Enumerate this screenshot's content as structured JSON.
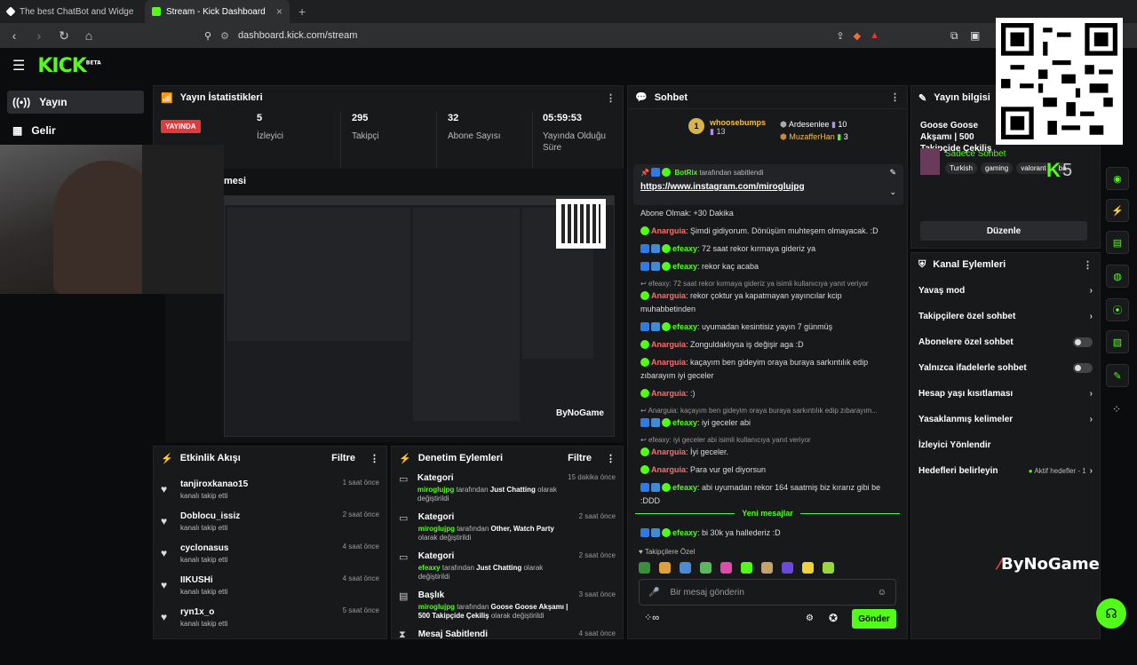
{
  "browser": {
    "tabs": [
      {
        "title": "The best ChatBot and Widgets for Ki",
        "active": false
      },
      {
        "title": "Stream - Kick Dashboard",
        "active": true
      }
    ],
    "url": "dashboard.kick.com/stream"
  },
  "brand": {
    "logo": "KICK",
    "beta": "BETA",
    "accent": "#53fc18"
  },
  "sidebar": {
    "items": [
      {
        "label": "Yayın",
        "icon": "broadcast-icon"
      },
      {
        "label": "Gelir",
        "icon": "revenue-icon"
      }
    ]
  },
  "stats": {
    "title": "Yayın İstatistikleri",
    "live_badge": "YAYINDA",
    "items": [
      {
        "value": "5",
        "label": "İzleyici"
      },
      {
        "value": "295",
        "label": "Takipçi"
      },
      {
        "value": "32",
        "label": "Abone Sayısı"
      },
      {
        "value": "05:59:53",
        "label": "Yayında Olduğu Süre"
      }
    ]
  },
  "preview": {
    "title_fragment": "mesi"
  },
  "activity": {
    "title": "Etkinlik Akışı",
    "filter": "Filtre",
    "items": [
      {
        "name": "tanjiroxkanao15",
        "sub": "kanalı takip etti",
        "time": "1 saat önce"
      },
      {
        "name": "Doblocu_issiz",
        "sub": "kanalı takip etti",
        "time": "2 saat önce"
      },
      {
        "name": "cyclonasus",
        "sub": "kanalı takip etti",
        "time": "4 saat önce"
      },
      {
        "name": "IIKUSHi",
        "sub": "kanalı takip etti",
        "time": "4 saat önce"
      },
      {
        "name": "ryn1x_o",
        "sub": "kanalı takip etti",
        "time": "5 saat önce"
      }
    ]
  },
  "moderation": {
    "title": "Denetim Eylemleri",
    "filter": "Filtre",
    "items": [
      {
        "kind": "Kategori",
        "user": "miroglujpg",
        "mid": "tarafından",
        "value": "Just Chatting",
        "end": "olarak değiştirildi",
        "time": "15 dakika önce"
      },
      {
        "kind": "Kategori",
        "user": "miroglujpg",
        "mid": "tarafından",
        "value": "Other, Watch Party",
        "end": "olarak değiştirildi",
        "time": "2 saat önce"
      },
      {
        "kind": "Kategori",
        "user": "efeaxy",
        "mid": "tarafından",
        "value": "Just Chatting",
        "end": "olarak değiştirildi",
        "time": "2 saat önce"
      },
      {
        "kind": "Başlık",
        "user": "miroglujpg",
        "mid": "tarafından",
        "value": "Goose Goose Akşamı | 500 Takipçide Çekiliş",
        "end": "olarak değiştirildi",
        "time": "3 saat önce"
      },
      {
        "kind": "Mesaj Sabitlendi",
        "user": "",
        "mid": "",
        "value": "",
        "end": "",
        "time": "4 saat önce"
      }
    ]
  },
  "chat": {
    "title": "Sohbet",
    "leaders": [
      {
        "rank": "1",
        "name": "whoosebumps",
        "count": "13"
      },
      {
        "name": "Ardesenlee",
        "count": "10"
      },
      {
        "name": "MuzafferHan",
        "count": "3"
      }
    ],
    "pinned": {
      "by": "BotRix",
      "by_text": "tarafından sabitlendi",
      "link": "https://www.instagram.com/miroglujpg"
    },
    "messages": [
      {
        "type": "plain",
        "text": "Abone Olmak: +30 Dakika"
      },
      {
        "type": "msg",
        "user": "Anarguia",
        "color": "#ff6b6b",
        "text": ": Şimdi gidiyorum. Dönüşüm muhteşem olmayacak. :D"
      },
      {
        "type": "msg",
        "user": "efeaxy",
        "color": "#53fc18",
        "text": ": 72 saat rekor kırmaya gideriz ya"
      },
      {
        "type": "msg",
        "user": "efeaxy",
        "color": "#53fc18",
        "text": ": rekor kaç acaba"
      },
      {
        "type": "reply",
        "text": "efeaxy: 72 saat rekor kırmaya gideriz ya isimli kullanıcıya yanıt veriyor"
      },
      {
        "type": "msg",
        "user": "Anarguia",
        "color": "#ff6b6b",
        "text": ": rekor çoktur ya kapatmayan yayıncılar kcip muhabbetinden"
      },
      {
        "type": "msg",
        "user": "efeaxy",
        "color": "#53fc18",
        "text": ": uyumadan kesintisiz yayın 7 günmüş"
      },
      {
        "type": "msg",
        "user": "Anarguia",
        "color": "#ff6b6b",
        "text": ": Zonguldaklıysa iş değişir aga :D"
      },
      {
        "type": "msg",
        "user": "Anarguia",
        "color": "#ff6b6b",
        "text": ": kaçayım ben gideyim oraya buraya sarkıntılık edip zıbarayım iyi geceler"
      },
      {
        "type": "msg",
        "user": "Anarguia",
        "color": "#ff6b6b",
        "text": ": :)"
      },
      {
        "type": "reply",
        "text": "Anarguia: kaçayım ben gideyim oraya buraya sarkıntılık edip zıbarayım..."
      },
      {
        "type": "msg",
        "user": "efeaxy",
        "color": "#53fc18",
        "text": ": iyi geceler abi"
      },
      {
        "type": "reply",
        "text": "efeaxy: iyi geceler abi    isimli kullanıcıya yanıt veriyor"
      },
      {
        "type": "msg",
        "user": "Anarguia",
        "color": "#ff6b6b",
        "text": ": İyi geceler."
      },
      {
        "type": "msg",
        "user": "Anarguia",
        "color": "#ff6b6b",
        "text": ": Para vur gel diyorsun"
      },
      {
        "type": "msg",
        "user": "efeaxy",
        "color": "#53fc18",
        "text": ": abi uyumadan rekor 164 saatmiş biz kırarız gibi be :DDD"
      }
    ],
    "new_messages": "Yeni mesajlar",
    "last_message": {
      "user": "efeaxy",
      "text": ": bi 30k ya hallederiz :D"
    },
    "followers_only": "Takipçilere Özel",
    "input_placeholder": "Bir mesaj gönderin",
    "send": "Gönder"
  },
  "stream_info": {
    "title": "Yayın bilgisi",
    "stream_title": "Goose Goose Akşamı | 500 Takipçide Çekiliş",
    "category": "Sadece Sohbet",
    "tags": [
      "Turkish",
      "gaming",
      "valorant",
      "ba"
    ],
    "edit": "Düzenle",
    "counter": "5"
  },
  "channel_actions": {
    "title": "Kanal Eylemleri",
    "items": [
      {
        "label": "Yavaş mod",
        "control": "chevron"
      },
      {
        "label": "Takipçilere özel sohbet",
        "control": "chevron"
      },
      {
        "label": "Abonelere özel sohbet",
        "control": "toggle"
      },
      {
        "label": "Yalnızca ifadelerle sohbet",
        "control": "toggle"
      },
      {
        "label": "Hesap yaşı kısıtlaması",
        "control": "chevron"
      },
      {
        "label": "Yasaklanmış kelimeler",
        "control": "chevron"
      },
      {
        "label": "İzleyici Yönlendir",
        "control": "none"
      },
      {
        "label": "Hedefleri belirleyin",
        "control": "chevron",
        "extra": "Aktif hedefler - 1"
      }
    ]
  },
  "watermark": "ByNoGame"
}
